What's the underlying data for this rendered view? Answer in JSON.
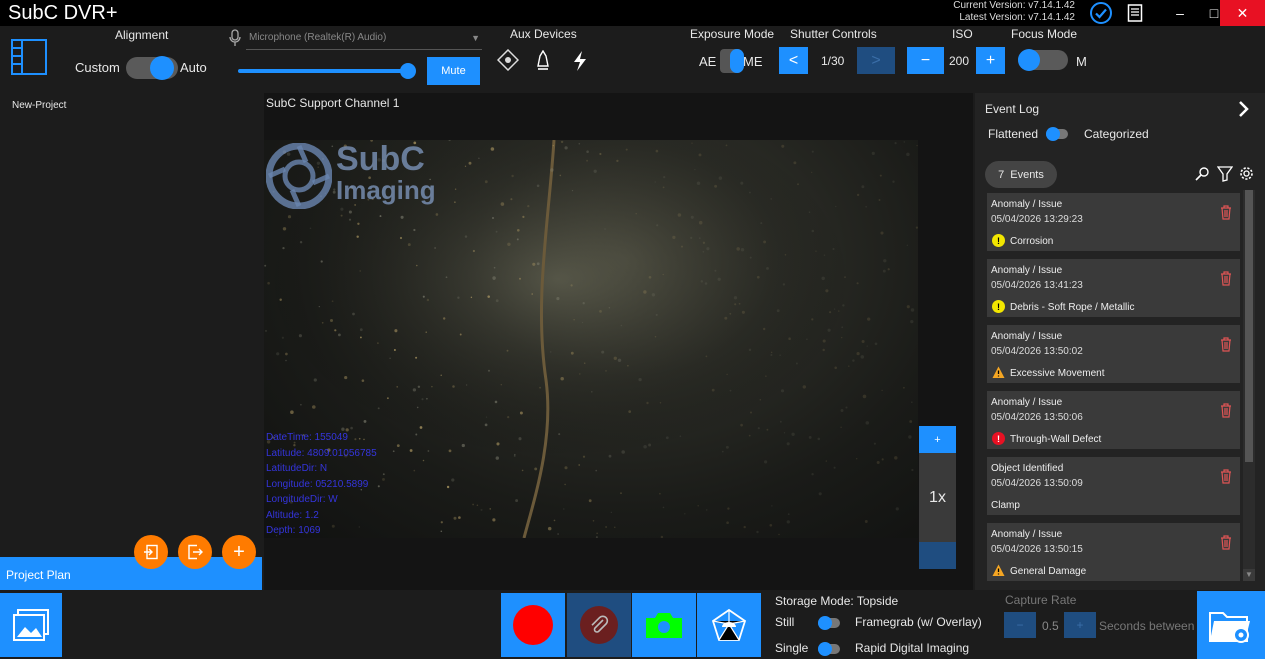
{
  "app": {
    "title": "SubC DVR+",
    "current_version": "Current Version: v7.14.1.42",
    "latest_version": "Latest Version: v7.14.1.42"
  },
  "toolbar": {
    "alignment": {
      "label": "Alignment",
      "left": "Custom",
      "right": "Auto"
    },
    "microphone": {
      "value": "Microphone (Realtek(R) Audio)",
      "volume": 1.0,
      "mute_label": "Mute"
    },
    "aux_devices": {
      "label": "Aux Devices"
    },
    "exposure": {
      "label": "Exposure Mode",
      "left": "AE",
      "right": "ME"
    },
    "shutter": {
      "label": "Shutter Controls",
      "dec": "<",
      "value": "1/30",
      "inc": ">"
    },
    "iso": {
      "label": "ISO",
      "dec": "−",
      "value": "200",
      "inc": "+"
    },
    "focus": {
      "label": "Focus Mode",
      "right": "M"
    }
  },
  "left_panel": {
    "project_item": "New-Project",
    "plan_label": "Project Plan"
  },
  "video": {
    "channel_title": "SubC Support Channel 1",
    "watermark_line1": "SubC",
    "watermark_line2": "Imaging",
    "overlay_lines": [
      "DateTime: 155049",
      "Latitude: 4809.01056785",
      "LatitudeDir: N",
      "Longitude: 05210.5899",
      "LongitudeDir: W",
      "Altitude: 1.2",
      "Depth: 1069"
    ],
    "zoom_in": "+",
    "zoom_level": "1x"
  },
  "event_log": {
    "title": "Event Log",
    "view_left": "Flattened",
    "view_right": "Categorized",
    "count": "7",
    "count_label": "Events",
    "events": [
      {
        "type": "Anomaly / Issue",
        "time": "05/04/2026 13:29:23",
        "label": "Corrosion",
        "severity": "yellow"
      },
      {
        "type": "Anomaly / Issue",
        "time": "05/04/2026 13:41:23",
        "label": "Debris - Soft Rope / Metallic",
        "severity": "yellow"
      },
      {
        "type": "Anomaly / Issue",
        "time": "05/04/2026 13:50:02",
        "label": "Excessive Movement",
        "severity": "orange"
      },
      {
        "type": "Anomaly / Issue",
        "time": "05/04/2026 13:50:06",
        "label": "Through-Wall Defect",
        "severity": "red"
      },
      {
        "type": "Object Identified",
        "time": "05/04/2026 13:50:09",
        "label": "Clamp",
        "severity": "none"
      },
      {
        "type": "Anomaly / Issue",
        "time": "05/04/2026 13:50:15",
        "label": "General Damage",
        "severity": "orange"
      }
    ]
  },
  "bottom": {
    "storage_mode": "Storage Mode: Topside",
    "still": "Still",
    "framegrab": "Framegrab (w/ Overlay)",
    "single": "Single",
    "rapid": "Rapid Digital Imaging",
    "capture_rate_label": "Capture Rate",
    "capture_rate_value": "0.5",
    "seconds_between": "Seconds between s"
  },
  "colors": {
    "accent": "#1e90ff",
    "record": "#ff0000",
    "orange": "#ff7b00",
    "camera": "#00ff00"
  }
}
